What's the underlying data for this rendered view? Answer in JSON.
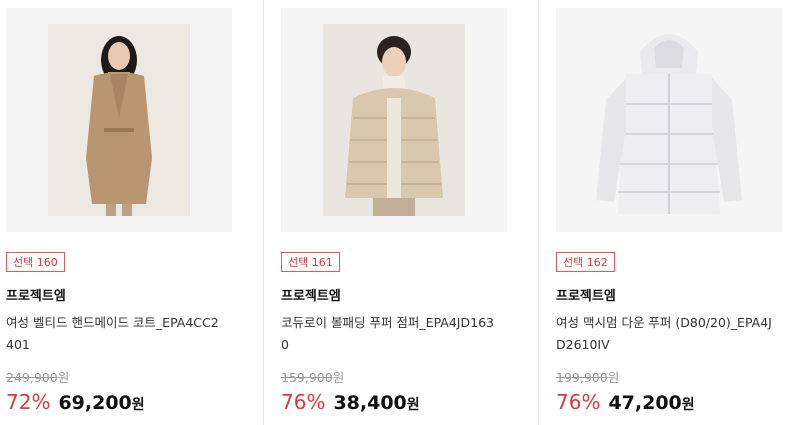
{
  "products": [
    {
      "badge": "선택 160",
      "brand": "프로젝트엠",
      "name_line1": "여성 벨티드 핸드메이드 코트_EPA4CC2",
      "name_line2": "401",
      "original_price": "249,900",
      "original_unit": "원",
      "discount": "72%",
      "sale_price": "69,200",
      "sale_unit": "원"
    },
    {
      "badge": "선택 161",
      "brand": "프로젝트엠",
      "name_line1": "코듀로이 볼패딩 푸퍼 점퍼_EPA4JD163",
      "name_line2": "0",
      "original_price": "159,900",
      "original_unit": "원",
      "discount": "76%",
      "sale_price": "38,400",
      "sale_unit": "원"
    },
    {
      "badge": "선택 162",
      "brand": "프로젝트엠",
      "name_line1": "여성 맥시멈 다운 푸퍼 (D80/20)_EPA4J",
      "name_line2": "D2610IV",
      "original_price": "199,900",
      "original_unit": "원",
      "discount": "76%",
      "sale_price": "47,200",
      "sale_unit": "원"
    }
  ]
}
